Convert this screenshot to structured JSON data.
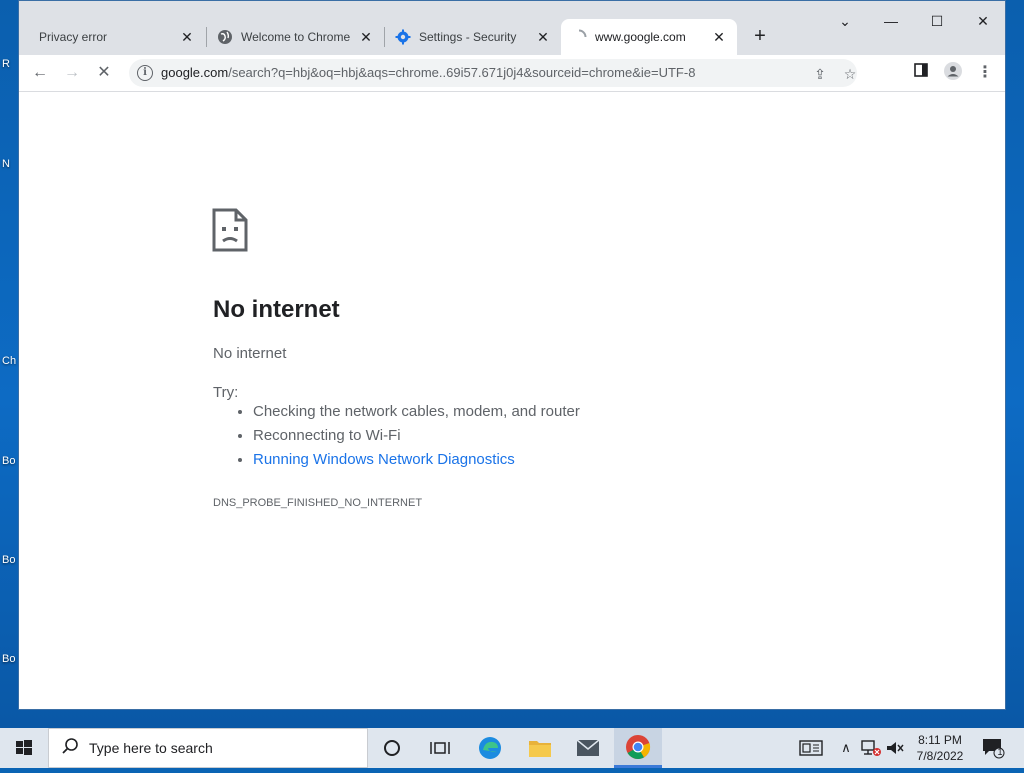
{
  "desktop": {
    "icon_labels": [
      "R",
      "N",
      "Ch",
      "Bo",
      "Bo",
      "Bo"
    ]
  },
  "tabs": [
    {
      "label": "Privacy error",
      "icon": "none"
    },
    {
      "label": "Welcome to Chrome",
      "icon": "chrome-globe-icon"
    },
    {
      "label": "Settings - Security",
      "icon": "gear-icon"
    },
    {
      "label": "www.google.com",
      "icon": "loading-spinner-icon",
      "active": true
    }
  ],
  "toolbar": {
    "url_host": "google.com",
    "url_rest": "/search?q=hbj&oq=hbj&aqs=chrome..69i57.671j0j4&sourceid=chrome&ie=UTF-8"
  },
  "error": {
    "title": "No internet",
    "subtitle": "No internet",
    "try_label": "Try:",
    "suggestions": [
      "Checking the network cables, modem, and router",
      "Reconnecting to Wi-Fi"
    ],
    "diagnostics_link": "Running Windows Network Diagnostics",
    "code": "DNS_PROBE_FINISHED_NO_INTERNET"
  },
  "taskbar": {
    "search_placeholder": "Type here to search",
    "time": "8:11 PM",
    "date": "7/8/2022",
    "notification_count": "1"
  },
  "colors": {
    "accent": "#1a73e8",
    "desktop": "#0b5fae"
  }
}
